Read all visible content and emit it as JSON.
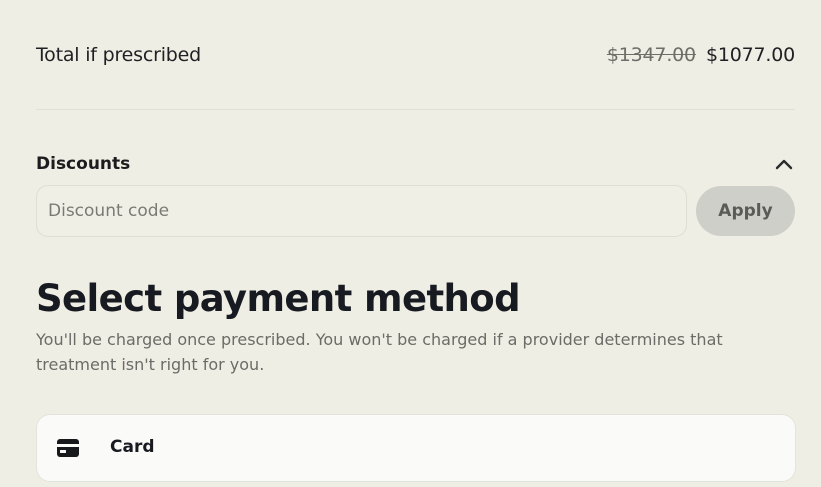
{
  "summary": {
    "total_label": "Total if prescribed",
    "original_price": "$1347.00",
    "discounted_price": "$1077.00"
  },
  "discounts": {
    "title": "Discounts",
    "expanded": true,
    "input_value": "",
    "input_placeholder": "Discount code",
    "apply_label": "Apply"
  },
  "payment": {
    "title": "Select payment method",
    "description": "You'll be charged once prescribed. You won't be charged if a provider determines that treatment isn't right for you.",
    "methods": [
      {
        "label": "Card",
        "icon": "credit-card-icon"
      }
    ]
  },
  "colors": {
    "background": "#efeee4",
    "text_primary": "#1f2023",
    "text_muted": "#6b6b67",
    "apply_button_bg": "#cfcfca",
    "card_option_bg": "#fafaf8"
  }
}
